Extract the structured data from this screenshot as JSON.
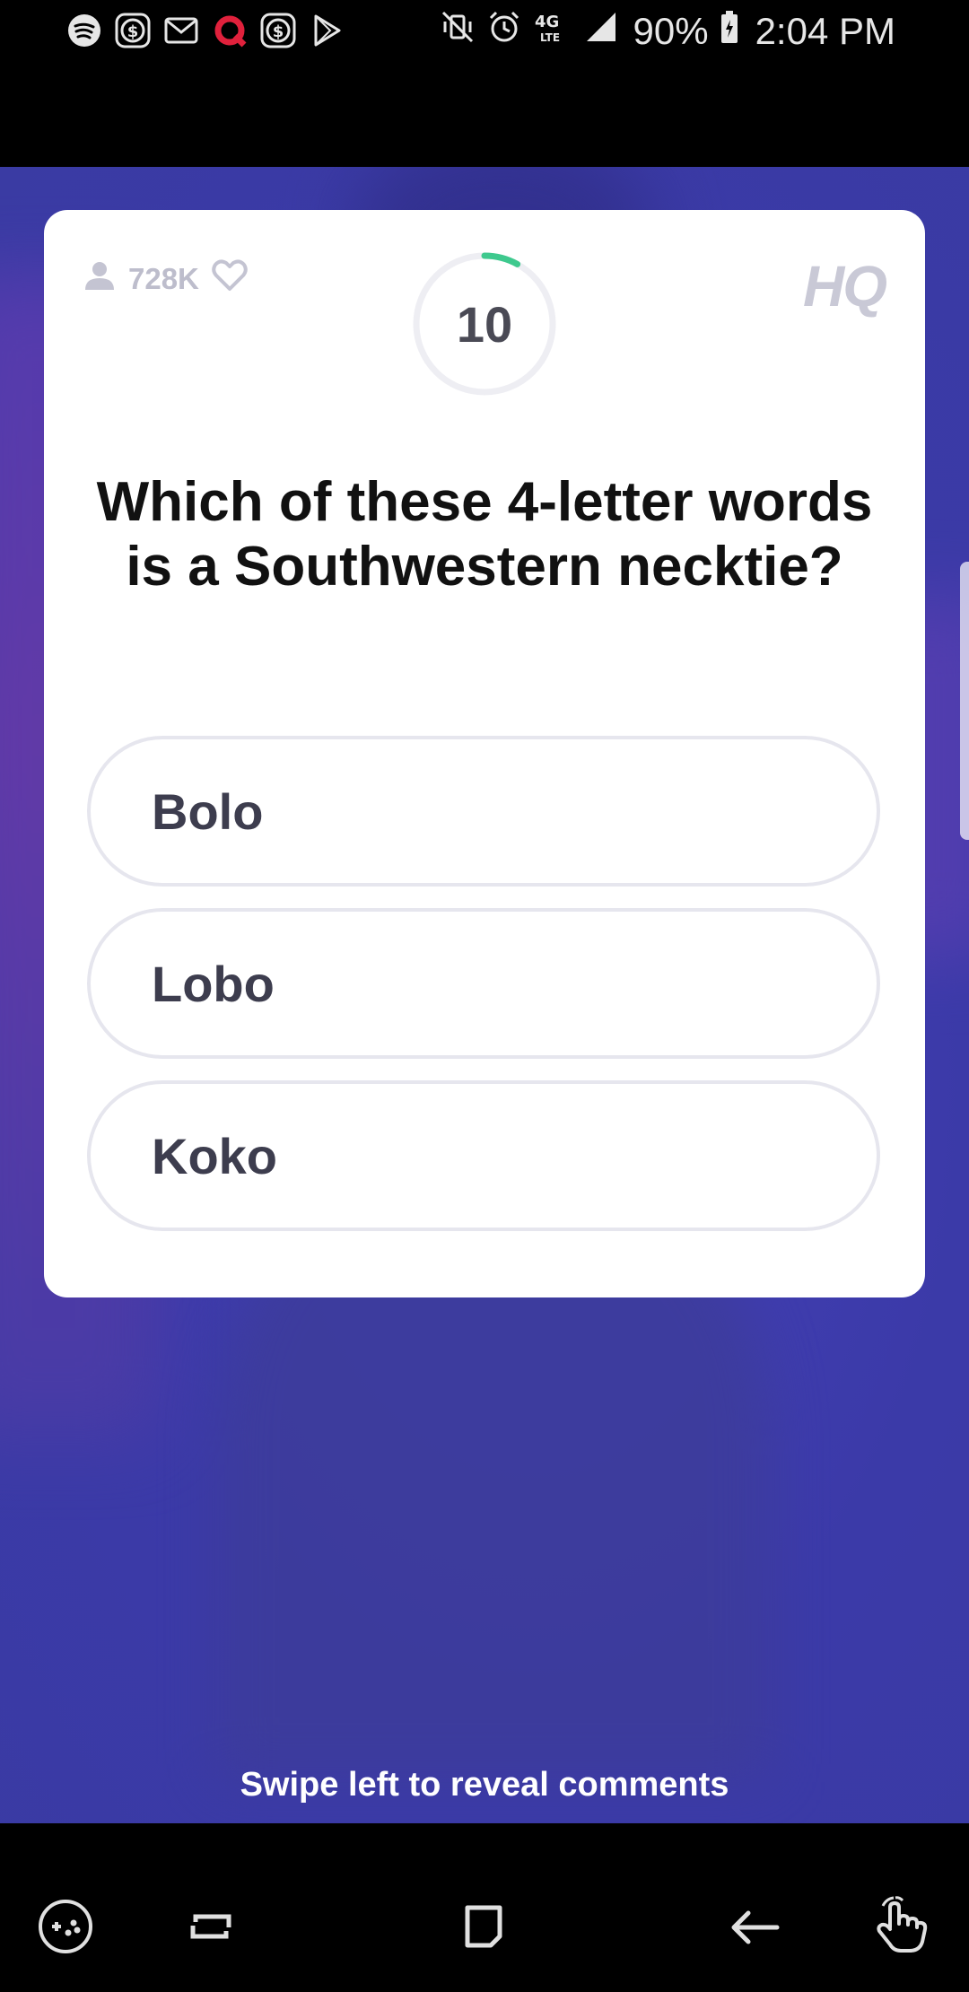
{
  "status_bar": {
    "battery": "90%",
    "time": "2:04 PM",
    "network": "4G LTE",
    "left_icons": [
      "spotify-icon",
      "cashapp-icon",
      "mail-icon",
      "theq-icon",
      "cashapp-icon",
      "play-store-icon"
    ],
    "right_icons": [
      "vibrate-mute-icon",
      "alarm-icon",
      "signal-icon",
      "battery-icon"
    ]
  },
  "card": {
    "viewers": "728K",
    "logo": "HQ",
    "timer": "10",
    "timer_progress": 0.08,
    "question": "Which of these 4-letter words is a Southwestern necktie?",
    "answers": [
      "Bolo",
      "Lobo",
      "Koko"
    ]
  },
  "swipe_hint": "Swipe left to reveal comments",
  "nav_bar": {
    "icons": [
      "game-tools-icon",
      "recents-icon",
      "home-icon",
      "back-icon",
      "one-hand-icon"
    ]
  },
  "colors": {
    "timer_arc": "#3ec98e",
    "card_bg": "#ffffff",
    "video_bg": "#3b3aa8"
  }
}
